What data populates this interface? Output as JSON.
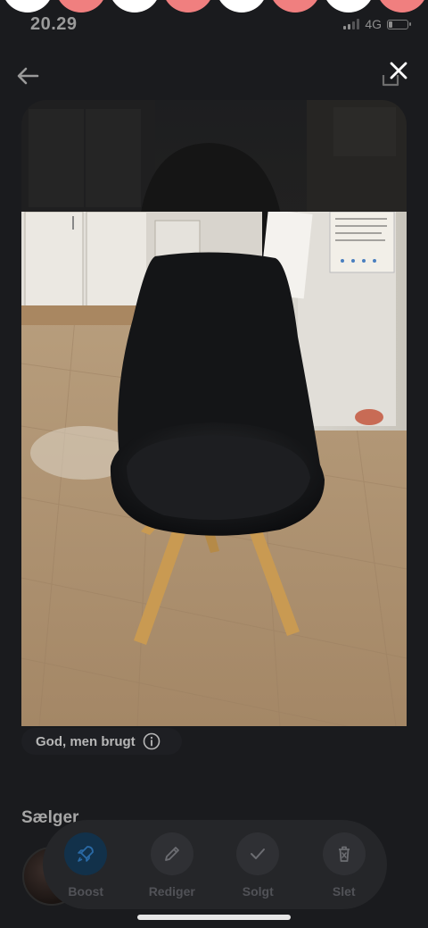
{
  "status_bar": {
    "time": "20.29",
    "network": "4G"
  },
  "stories": {
    "colors": [
      "#ffffff",
      "#f07f7f",
      "#ffffff",
      "#f07f7f",
      "#ffffff",
      "#f07f7f",
      "#ffffff",
      "#f07f7f"
    ]
  },
  "header": {
    "back_icon": "arrow-left-icon",
    "share_icon": "share-icon",
    "close_icon": "close-icon"
  },
  "listing": {
    "condition": "God, men brugt",
    "condition_icon": "info-icon"
  },
  "seller": {
    "heading": "Sælger"
  },
  "actions": [
    {
      "label": "Boost",
      "icon": "rocket-icon"
    },
    {
      "label": "Rediger",
      "icon": "pencil-icon"
    },
    {
      "label": "Solgt",
      "icon": "check-icon"
    },
    {
      "label": "Slet",
      "icon": "trash-icon"
    }
  ],
  "colors": {
    "background": "#1a1b1e",
    "boost_accent": "#12314a",
    "action_bar": "#252629"
  }
}
